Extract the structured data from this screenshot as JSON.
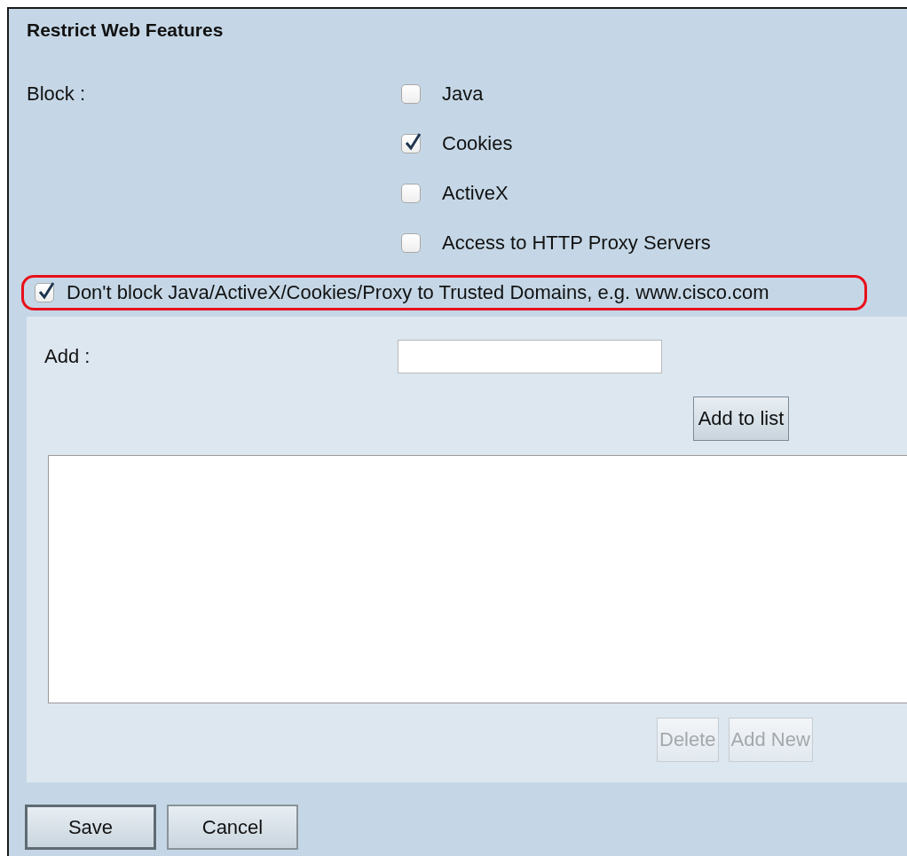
{
  "section_title": "Restrict Web Features",
  "block": {
    "label": "Block :",
    "options": [
      {
        "label": "Java",
        "checked": false
      },
      {
        "label": "Cookies",
        "checked": true
      },
      {
        "label": "ActiveX",
        "checked": false
      },
      {
        "label": "Access to HTTP Proxy Servers",
        "checked": false
      }
    ]
  },
  "trusted_domains": {
    "label": "Don't block Java/ActiveX/Cookies/Proxy to Trusted Domains, e.g. www.cisco.com",
    "checked": true,
    "highlighted": true,
    "add_label": "Add :",
    "add_button": "Add to list",
    "list_buttons": [
      {
        "label": "Delete",
        "disabled": true
      },
      {
        "label": "Add New",
        "disabled": true
      }
    ]
  },
  "buttons": [
    {
      "label": "Save",
      "default": true
    },
    {
      "label": "Cancel",
      "default": false
    }
  ]
}
